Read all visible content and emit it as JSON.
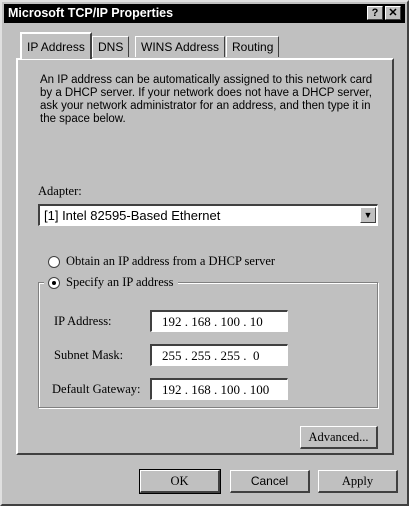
{
  "window": {
    "title": "Microsoft TCP/IP Properties",
    "help_button": "?",
    "close_button": "✕"
  },
  "tabs": [
    {
      "label": "IP Address",
      "active": true
    },
    {
      "label": "DNS",
      "active": false
    },
    {
      "label": "WINS Address",
      "active": false
    },
    {
      "label": "Routing",
      "active": false
    }
  ],
  "description": "An IP address can be automatically assigned to this network card by a DHCP server.  If your network does not have a DHCP server, ask your network administrator for an address, and then type it in the space below.",
  "adapter": {
    "label": "Adapter:",
    "value": "[1] Intel 82595-Based Ethernet"
  },
  "options": {
    "dhcp_label": "Obtain an IP address from a DHCP server",
    "dhcp_selected": false,
    "specify_label": "Specify an IP address",
    "specify_selected": true
  },
  "fields": {
    "ip_label": "IP Address:",
    "ip_value": "192 . 168 . 100 . 10",
    "subnet_label": "Subnet Mask:",
    "subnet_value": "255 . 255 . 255 .  0",
    "gateway_label": "Default Gateway:",
    "gateway_value": "192 . 168 . 100 . 100"
  },
  "buttons": {
    "advanced": "Advanced...",
    "ok": "OK",
    "cancel": "Cancel",
    "apply": "Apply"
  }
}
